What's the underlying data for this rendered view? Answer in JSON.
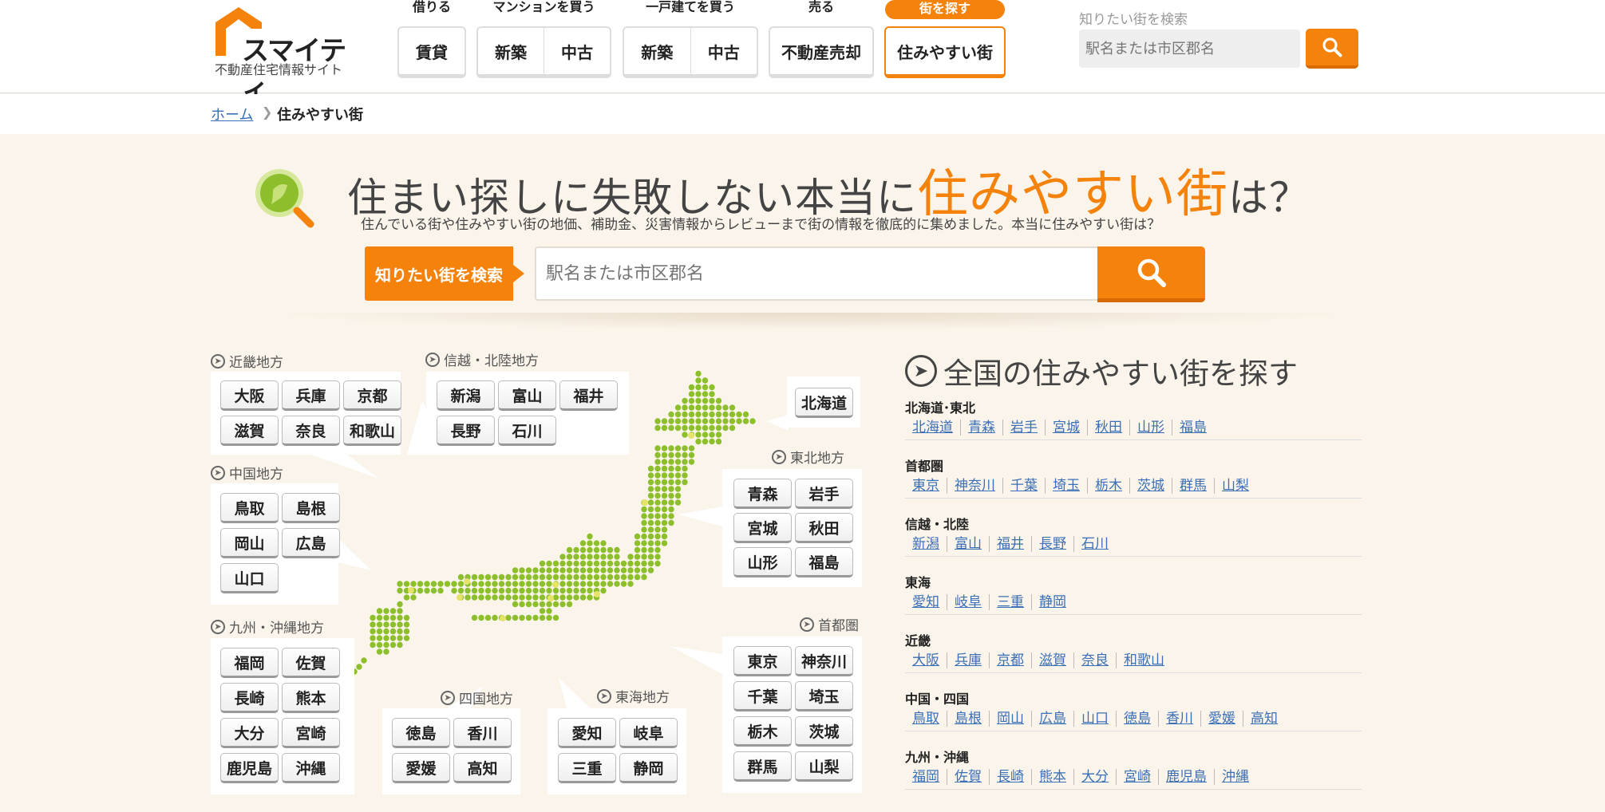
{
  "header": {
    "logo_name": "スマイティ",
    "logo_tag": "不動産住宅情報サイト",
    "nav": [
      {
        "caption": "借りる",
        "buttons": [
          "賃貸"
        ]
      },
      {
        "caption": "マンションを買う",
        "buttons": [
          "新築",
          "中古"
        ]
      },
      {
        "caption": "一戸建てを買う",
        "buttons": [
          "新築",
          "中古"
        ]
      },
      {
        "caption": "売る",
        "buttons": [
          "不動産売却"
        ]
      },
      {
        "caption": "街を探す",
        "buttons": [
          "住みやすい街"
        ]
      }
    ],
    "search_label": "知りたい街を検索",
    "search_placeholder": "駅名または市区郡名"
  },
  "breadcrumb": {
    "home": "ホーム",
    "current": "住みやすい街"
  },
  "hero": {
    "title_before": "住まい探しに失敗しない本当に",
    "title_accent": "住みやすい街",
    "title_after": "は？",
    "subtitle": "住んでいる街や住みやすい街の地価、補助金、災害情報からレビューまで街の情報を徹底的に集めました。本当に住みやすい街は？",
    "search_tag": "知りたい街を検索",
    "search_placeholder": "駅名または市区郡名"
  },
  "map_regions": {
    "kinki": {
      "title": "近畿地方",
      "prefs": [
        "大阪",
        "兵庫",
        "京都",
        "滋賀",
        "奈良",
        "和歌山"
      ]
    },
    "shinetsu": {
      "title": "信越・北陸地方",
      "prefs": [
        "新潟",
        "富山",
        "福井",
        "長野",
        "石川"
      ]
    },
    "hokkaido": {
      "prefs": [
        "北海道"
      ]
    },
    "tohoku": {
      "title": "東北地方",
      "prefs": [
        "青森",
        "岩手",
        "宮城",
        "秋田",
        "山形",
        "福島"
      ]
    },
    "chugoku": {
      "title": "中国地方",
      "prefs": [
        "鳥取",
        "島根",
        "岡山",
        "広島",
        "山口"
      ]
    },
    "kyushu": {
      "title": "九州・沖縄地方",
      "prefs": [
        "福岡",
        "佐賀",
        "長崎",
        "熊本",
        "大分",
        "宮崎",
        "鹿児島",
        "沖縄"
      ]
    },
    "shikoku": {
      "title": "四国地方",
      "prefs": [
        "徳島",
        "香川",
        "愛媛",
        "高知"
      ]
    },
    "tokai": {
      "title": "東海地方",
      "prefs": [
        "愛知",
        "岐阜",
        "三重",
        "静岡"
      ]
    },
    "shutoken": {
      "title": "首都圏",
      "prefs": [
        "東京",
        "神奈川",
        "千葉",
        "埼玉",
        "栃木",
        "茨城",
        "群馬",
        "山梨"
      ]
    }
  },
  "list": {
    "heading": "全国の住みやすい街を探す",
    "regions": [
      {
        "name": "北海道･東北",
        "prefs": [
          "北海道",
          "青森",
          "岩手",
          "宮城",
          "秋田",
          "山形",
          "福島"
        ]
      },
      {
        "name": "首都圏",
        "prefs": [
          "東京",
          "神奈川",
          "千葉",
          "埼玉",
          "栃木",
          "茨城",
          "群馬",
          "山梨"
        ]
      },
      {
        "name": "信越・北陸",
        "prefs": [
          "新潟",
          "富山",
          "福井",
          "長野",
          "石川"
        ]
      },
      {
        "name": "東海",
        "prefs": [
          "愛知",
          "岐阜",
          "三重",
          "静岡"
        ]
      },
      {
        "name": "近畿",
        "prefs": [
          "大阪",
          "兵庫",
          "京都",
          "滋賀",
          "奈良",
          "和歌山"
        ]
      },
      {
        "name": "中国・四国",
        "prefs": [
          "鳥取",
          "島根",
          "岡山",
          "広島",
          "山口",
          "徳島",
          "香川",
          "愛媛",
          "高知"
        ]
      },
      {
        "name": "九州・沖縄",
        "prefs": [
          "福岡",
          "佐賀",
          "長崎",
          "熊本",
          "大分",
          "宮崎",
          "鹿児島",
          "沖縄"
        ]
      }
    ]
  },
  "colors": {
    "accent": "#f5820b",
    "link": "#3b6fb6",
    "map_green": "#8cbf2b",
    "background": "#faf4ea"
  },
  "icons": [
    "house-logo-icon",
    "search-icon",
    "magnifier-map-icon",
    "arrow-circle-icon",
    "chevron-right-icon"
  ]
}
